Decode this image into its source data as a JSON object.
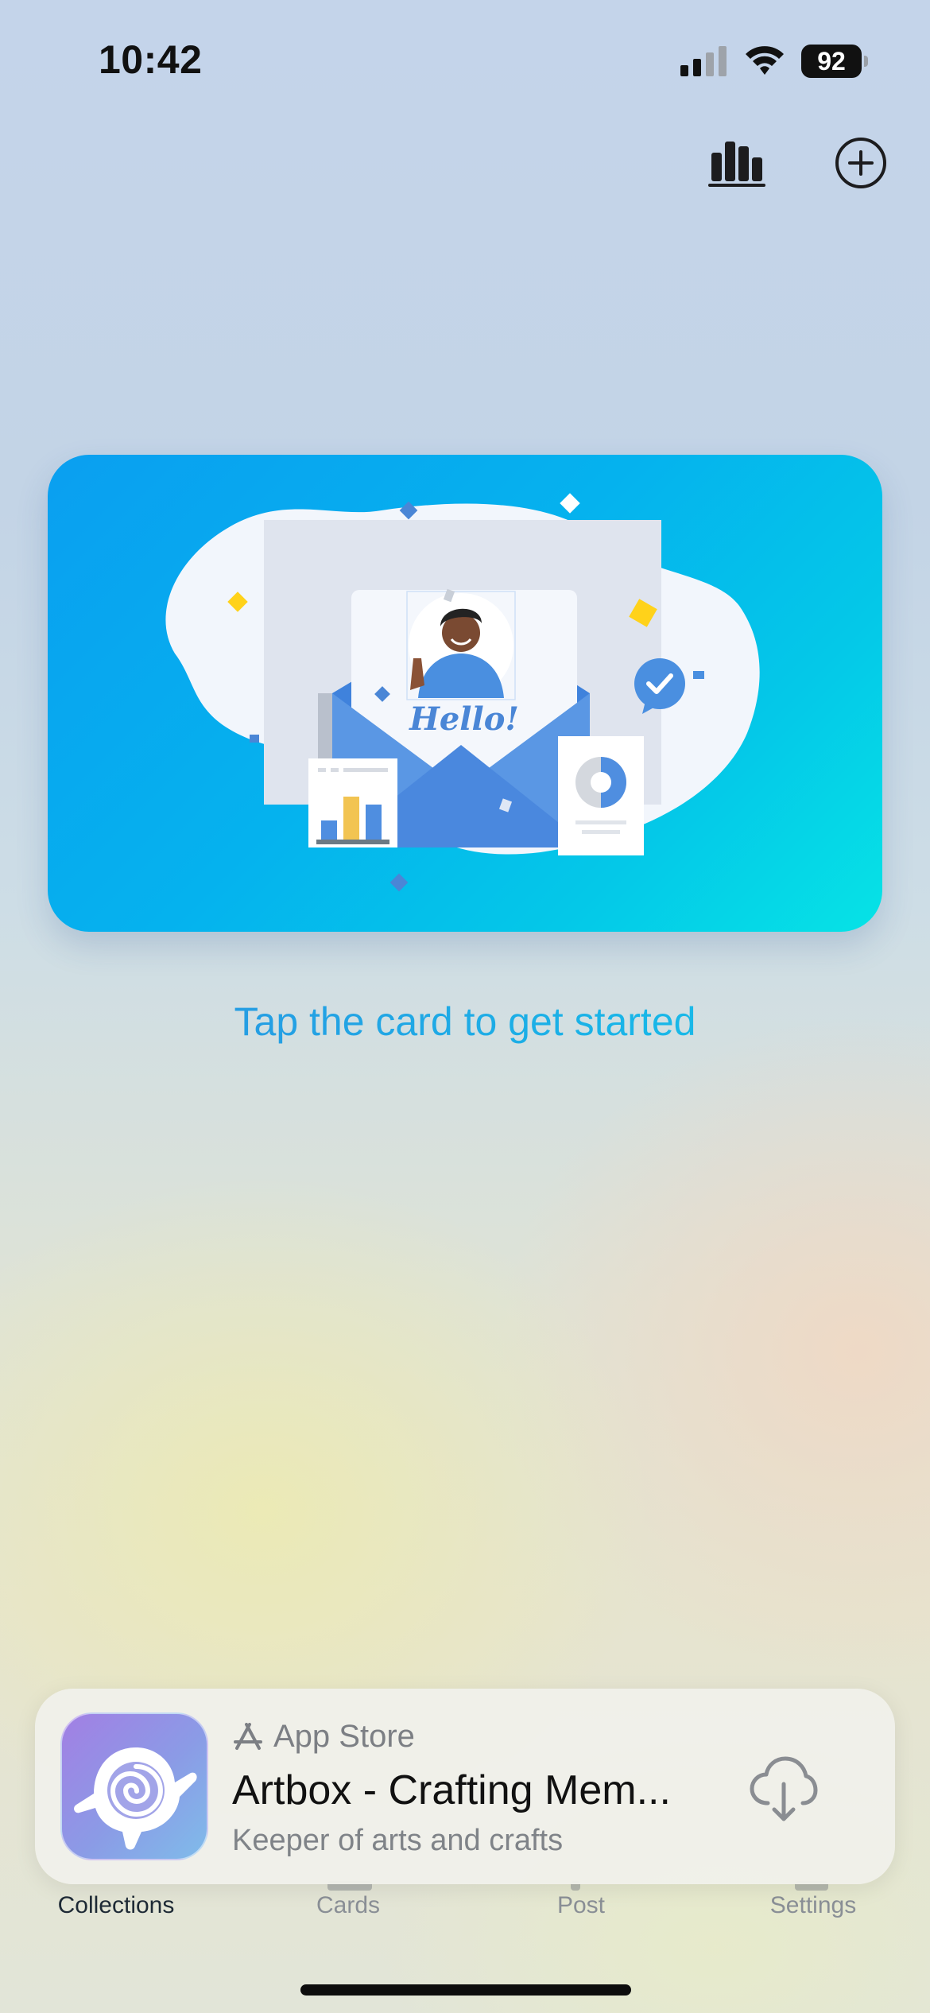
{
  "status_bar": {
    "time": "10:42",
    "battery": "92",
    "signal_icon": "signal-bars-icon",
    "wifi_icon": "wifi-icon"
  },
  "header": {
    "stats_icon": "bar-chart-icon",
    "add_icon": "plus-circle-icon"
  },
  "card": {
    "illustration_text": "Hello!",
    "gradient_start": "#0a9ff0",
    "gradient_end": "#06e3e6"
  },
  "prompt": "Tap the card to get started",
  "ad_banner": {
    "store_label": "App Store",
    "app_title": "Artbox - Crafting Mem...",
    "app_subtitle": "Keeper of arts and crafts",
    "icon": "turtle-app-icon",
    "action_icon": "cloud-download-icon"
  },
  "tabs": [
    {
      "label": "Collections",
      "active": true
    },
    {
      "label": "Cards",
      "active": false
    },
    {
      "label": "Post",
      "active": false
    },
    {
      "label": "Settings",
      "active": false
    }
  ],
  "colors": {
    "accent": "#18b6e8",
    "text_dark": "#111111",
    "tab_inactive": "#8a8f96"
  }
}
